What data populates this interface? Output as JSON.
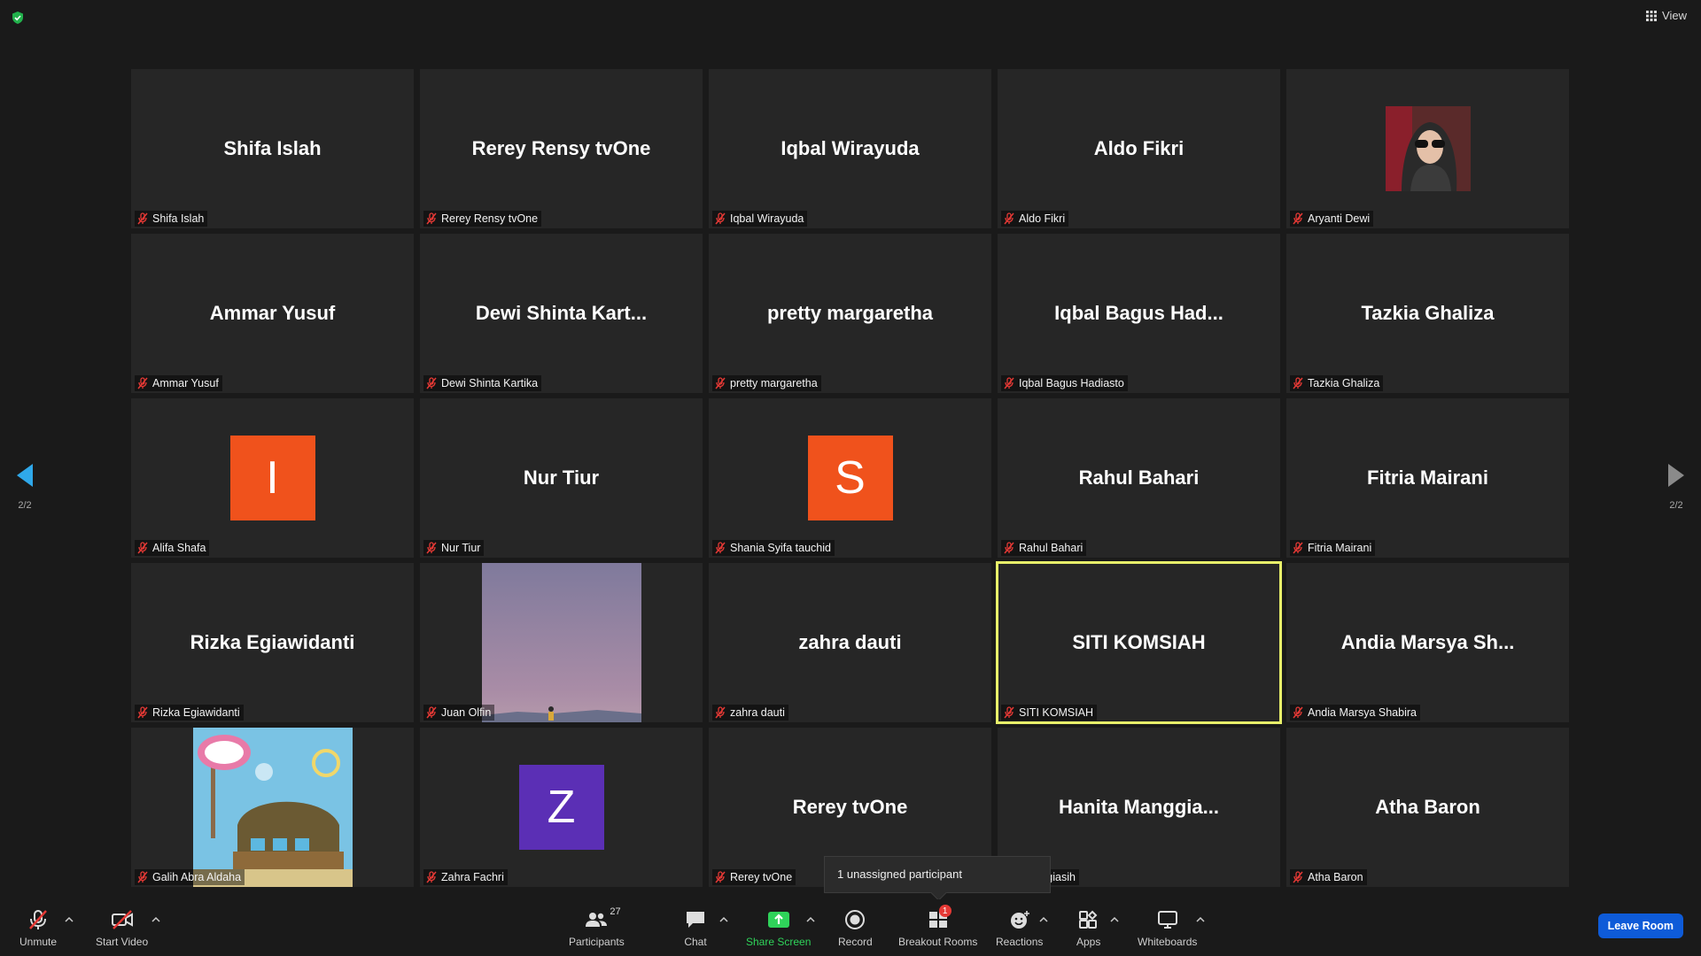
{
  "topbar": {
    "view_label": "View"
  },
  "navigation": {
    "left_page": "2/2",
    "right_page": "2/2"
  },
  "participants": [
    {
      "name": "Shifa Islah",
      "display": "Shifa Islah",
      "type": "name"
    },
    {
      "name": "Rerey Rensy tvOne",
      "display": "Rerey Rensy tvOne",
      "type": "name"
    },
    {
      "name": "Iqbal Wirayuda",
      "display": "Iqbal Wirayuda",
      "type": "name"
    },
    {
      "name": "Aldo Fikri",
      "display": "Aldo Fikri",
      "type": "name"
    },
    {
      "name": "Aryanti Dewi",
      "display": "",
      "type": "photo"
    },
    {
      "name": "Ammar Yusuf",
      "display": "Ammar Yusuf",
      "type": "name"
    },
    {
      "name": "Dewi Shinta Kartika",
      "display": "Dewi Shinta Kart...",
      "type": "name"
    },
    {
      "name": "pretty margaretha",
      "display": "pretty margaretha",
      "type": "name"
    },
    {
      "name": "Iqbal Bagus Hadiasto",
      "display": "Iqbal Bagus Had...",
      "type": "name"
    },
    {
      "name": "Tazkia Ghaliza",
      "display": "Tazkia Ghaliza",
      "type": "name"
    },
    {
      "name": "Alifa Shafa",
      "display": "I",
      "type": "avatar",
      "color": "#f0521c"
    },
    {
      "name": "Nur Tiur",
      "display": "Nur Tiur",
      "type": "name"
    },
    {
      "name": "Shania Syifa tauchid",
      "display": "S",
      "type": "avatar",
      "color": "#f0521c"
    },
    {
      "name": "Rahul Bahari",
      "display": "Rahul Bahari",
      "type": "name"
    },
    {
      "name": "Fitria Mairani",
      "display": "Fitria Mairani",
      "type": "name"
    },
    {
      "name": "Rizka Egiawidanti",
      "display": "Rizka Egiawidanti",
      "type": "name"
    },
    {
      "name": "Juan Olfin",
      "display": "",
      "type": "video"
    },
    {
      "name": "zahra dauti",
      "display": "zahra dauti",
      "type": "name"
    },
    {
      "name": "SITI KOMSIAH",
      "display": "SITI KOMSIAH",
      "type": "name",
      "active": true
    },
    {
      "name": "Andia Marsya Shabira",
      "display": "Andia Marsya Sh...",
      "type": "name"
    },
    {
      "name": "Galih Abra Aldaha",
      "display": "",
      "type": "krusty"
    },
    {
      "name": "Zahra Fachri",
      "display": "Z",
      "type": "avatar",
      "color": "#5b2fb5"
    },
    {
      "name": "Rerey tvOne",
      "display": "Rerey tvOne",
      "type": "name"
    },
    {
      "name": "Manggiasih",
      "display": "Hanita Manggia...",
      "type": "name"
    },
    {
      "name": "Atha Baron",
      "display": "Atha Baron",
      "type": "name"
    }
  ],
  "tooltip": {
    "text": "1 unassigned participant"
  },
  "toolbar": {
    "unmute": "Unmute",
    "start_video": "Start Video",
    "participants": "Participants",
    "participants_count": "27",
    "chat": "Chat",
    "share_screen": "Share Screen",
    "record": "Record",
    "breakout_rooms": "Breakout Rooms",
    "breakout_badge": "1",
    "reactions": "Reactions",
    "apps": "Apps",
    "whiteboards": "Whiteboards",
    "leave": "Leave Room"
  },
  "colors": {
    "accent_green": "#2fd35a",
    "active_border": "#e8f06a",
    "leave_blue": "#0e5bd8",
    "mute_red": "#e53935"
  }
}
